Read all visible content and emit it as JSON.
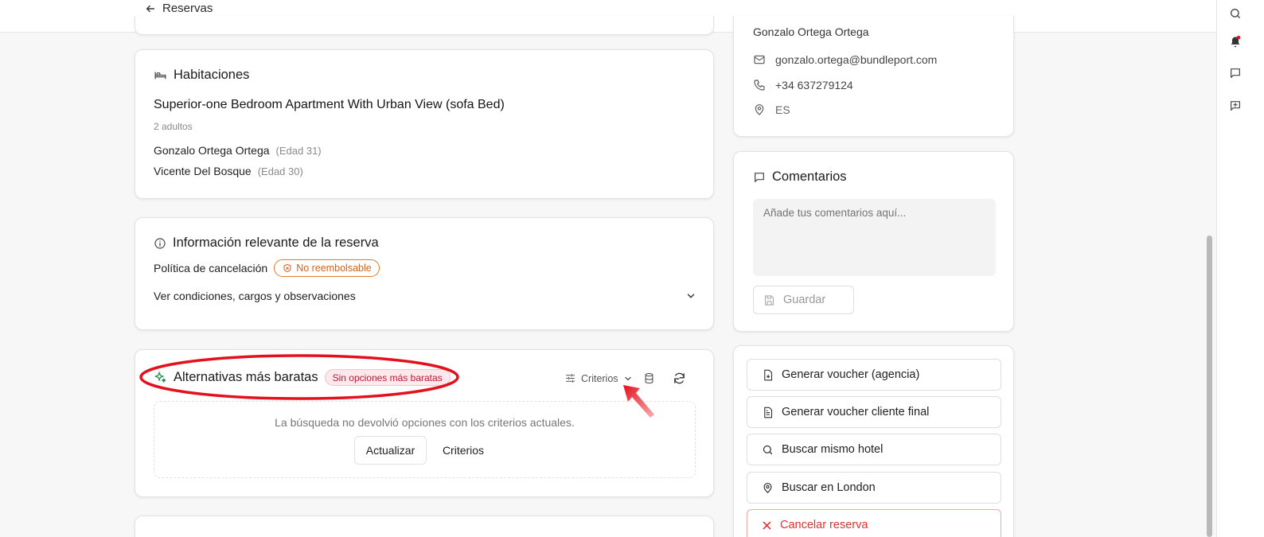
{
  "header": {
    "back_label": "Reservas"
  },
  "rooms": {
    "title": "Habitaciones",
    "room_name": "Superior-one Bedroom Apartment With Urban View (sofa Bed)",
    "occupancy": "2 adultos",
    "guests": [
      {
        "name": "Gonzalo Ortega Ortega",
        "age": "(Edad 31)"
      },
      {
        "name": "Vicente Del Bosque",
        "age": "(Edad 30)"
      }
    ]
  },
  "info": {
    "title": "Información relevante de la reserva",
    "policy_label": "Política de cancelación",
    "policy_badge": "No reembolsable",
    "conditions_link": "Ver condiciones, cargos y observaciones"
  },
  "alternatives": {
    "title": "Alternativas más baratas",
    "badge": "Sin opciones más baratas",
    "criteria_label": "Criterios",
    "empty_message": "La búsqueda no devolvió opciones con los criterios actuales.",
    "update_button": "Actualizar",
    "criteria_button": "Criterios"
  },
  "contact": {
    "name_partial": "Gonzalo Ortega Ortega",
    "email": "gonzalo.ortega@bundleport.com",
    "phone": "+34 637279124",
    "country": "ES"
  },
  "comments": {
    "title": "Comentarios",
    "placeholder": "Añade tus comentarios aquí...",
    "save_button": "Guardar"
  },
  "actions": {
    "items": [
      {
        "label": "Generar voucher (agencia)",
        "icon": "file-download-icon"
      },
      {
        "label": "Generar voucher cliente final",
        "icon": "file-text-icon"
      },
      {
        "label": "Buscar mismo hotel",
        "icon": "search-icon"
      },
      {
        "label": "Buscar en London",
        "icon": "map-pin-icon"
      }
    ],
    "cancel_label": "Cancelar reserva"
  },
  "colors": {
    "highlight_red": "#e3101e",
    "badge_orange": "#d1621b",
    "badge_red": "#b51b35",
    "cancel_red": "#e1322f",
    "sparkle_green": "#1e8e4e"
  }
}
